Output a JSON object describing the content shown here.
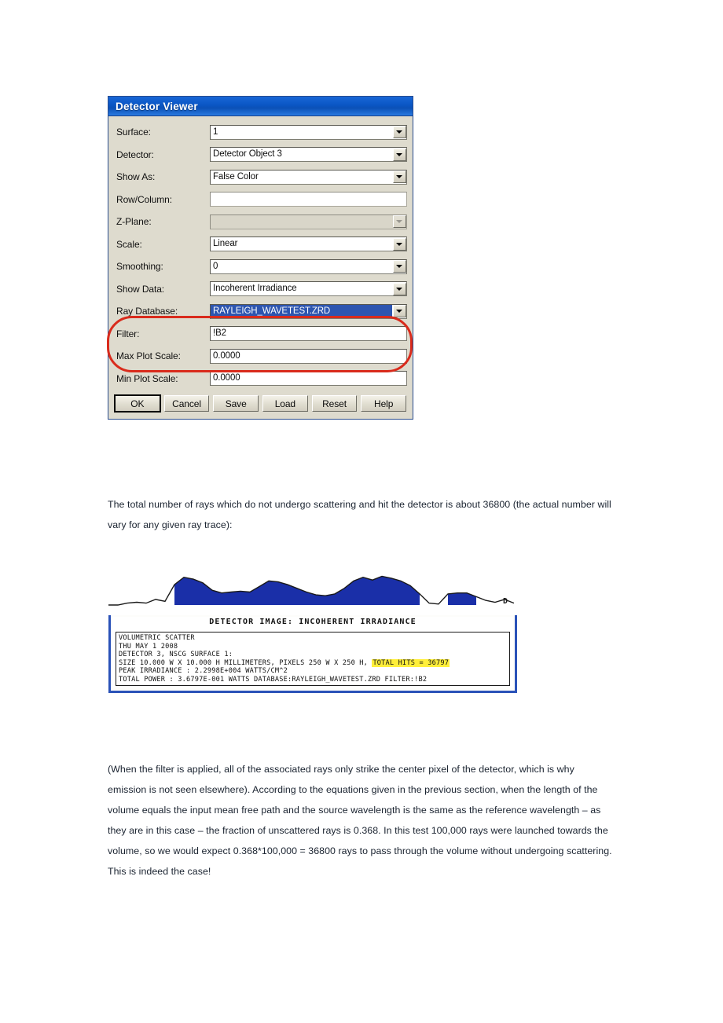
{
  "dialog": {
    "title": "Detector Viewer",
    "fields": [
      {
        "label": "Surface:",
        "value": "1",
        "control": "combo",
        "disabled": false,
        "selected": false
      },
      {
        "label": "Detector:",
        "value": "Detector Object 3",
        "control": "combo",
        "disabled": false,
        "selected": false
      },
      {
        "label": "Show As:",
        "value": "False Color",
        "control": "combo",
        "disabled": false,
        "selected": false
      },
      {
        "label": "Row/Column:",
        "value": "",
        "control": "text",
        "disabled": true,
        "selected": false
      },
      {
        "label": "Z-Plane:",
        "value": "",
        "control": "combo",
        "disabled": true,
        "selected": false
      },
      {
        "label": "Scale:",
        "value": "Linear",
        "control": "combo",
        "disabled": false,
        "selected": false
      },
      {
        "label": "Smoothing:",
        "value": "0",
        "control": "combo",
        "disabled": false,
        "selected": false
      },
      {
        "label": "Show Data:",
        "value": "Incoherent Irradiance",
        "control": "combo",
        "disabled": false,
        "selected": false
      },
      {
        "label": "Ray Database:",
        "value": "RAYLEIGH_WAVETEST.ZRD",
        "control": "combo",
        "disabled": false,
        "selected": true
      },
      {
        "label": "Filter:",
        "value": "!B2",
        "control": "text",
        "disabled": false,
        "selected": false
      },
      {
        "label": "Max Plot Scale:",
        "value": "0.0000",
        "control": "text",
        "disabled": false,
        "selected": false
      },
      {
        "label": "Min Plot Scale:",
        "value": "0.0000",
        "control": "text",
        "disabled": false,
        "selected": false
      }
    ],
    "buttons": [
      {
        "label": "OK",
        "default": true
      },
      {
        "label": "Cancel",
        "default": false
      },
      {
        "label": "Save",
        "default": false
      },
      {
        "label": "Load",
        "default": false
      },
      {
        "label": "Reset",
        "default": false
      },
      {
        "label": "Help",
        "default": false
      }
    ],
    "annotation": {
      "shape": "red-oval",
      "color": "#d92b1c",
      "targets": "Ray Database and Filter rows"
    }
  },
  "paragraphs": {
    "intro": "The total number of rays which do not undergo scattering and hit the detector is about 36800 (the actual number will vary for any given ray trace):",
    "conclusion": "(When the filter is applied, all of the associated rays only strike the center pixel of the detector, which is why emission is not seen elsewhere). According to the equations given in the previous section, when the length of the volume equals the input mean free path and the source wavelength is the same as the reference wavelength – as they are in this case – the fraction of unscattered rays is 0.368. In this test 100,000 rays were launched towards the volume, so we would expect 0.368*100,000 = 36800 rays to pass through the volume without undergoing scattering. This is indeed the case!"
  },
  "detector_image": {
    "caption": "DETECTOR IMAGE: INCOHERENT IRRADIANCE",
    "corner_letter": "D",
    "lines": {
      "line1": "VOLUMETRIC SCATTER",
      "line2": "THU MAY 1 2008",
      "line3": "DETECTOR 3, NSCG SURFACE 1:",
      "line4_a": "SIZE 10.000 W X 10.000 H MILLIMETERS, PIXELS 250 W X 250 H,",
      "line4_highlight": "TOTAL HITS = 36797",
      "line5": "PEAK IRRADIANCE : 2.2998E+004 WATTS/CM^2",
      "line6": "TOTAL POWER     : 3.6797E-001 WATTS DATABASE:RAYLEIGH_WAVETEST.ZRD FILTER:!B2"
    },
    "scan_artifact": {
      "description": "blue waveform band across top of scanned figure",
      "color": "#1a2fa8"
    }
  },
  "chart_data": {
    "type": "area",
    "title": "DETECTOR IMAGE: INCOHERENT IRRADIANCE",
    "xlabel": "",
    "ylabel": "",
    "grid": false,
    "legend": null,
    "note": "Scan artifact waveform band along the top edge of the detector image figure; amplitude sampled left-to-right across 520 px width.",
    "x": [
      0,
      12,
      24,
      36,
      48,
      60,
      72,
      84,
      96,
      108,
      120,
      132,
      144,
      156,
      168,
      180,
      192,
      204,
      216,
      228,
      240,
      252,
      264,
      276,
      288,
      300,
      312,
      324,
      336,
      348,
      360,
      372,
      384,
      396,
      408,
      420,
      432,
      444,
      456,
      468,
      480,
      492,
      504,
      516
    ],
    "values": [
      0,
      0,
      2,
      3,
      2,
      6,
      4,
      22,
      30,
      28,
      24,
      16,
      13,
      14,
      15,
      14,
      20,
      26,
      25,
      22,
      18,
      14,
      11,
      10,
      12,
      18,
      26,
      30,
      27,
      31,
      29,
      26,
      21,
      12,
      2,
      1,
      12,
      13,
      13,
      9,
      5,
      3,
      6,
      2
    ],
    "ylim": [
      0,
      34
    ],
    "fill_color": "#1a2fa8"
  }
}
